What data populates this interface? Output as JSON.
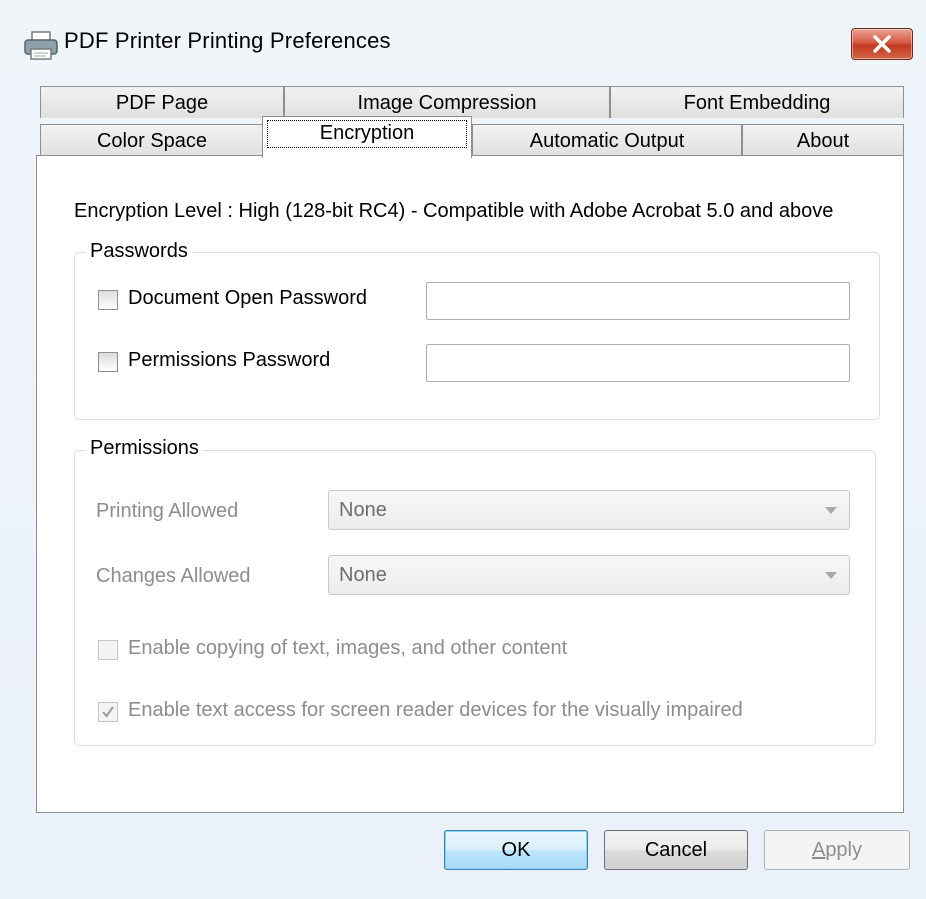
{
  "window": {
    "title": "PDF Printer Printing Preferences",
    "close_icon": "close-x-icon"
  },
  "tabs": {
    "row_back": [
      "PDF Page",
      "Image Compression",
      "Font Embedding"
    ],
    "row_front": [
      "Color Space",
      "Encryption",
      "Automatic Output",
      "About"
    ],
    "selected": "Encryption"
  },
  "encryption": {
    "level_text": "Encryption Level : High (128-bit RC4) - Compatible with Adobe Acrobat 5.0 and above"
  },
  "passwords": {
    "group_label": "Passwords",
    "doc_open_label": "Document Open Password",
    "doc_open_checked": false,
    "doc_open_value": "",
    "permissions_label": "Permissions Password",
    "permissions_checked": false,
    "permissions_value": ""
  },
  "permissions": {
    "group_label": "Permissions",
    "printing_label": "Printing Allowed",
    "printing_value": "None",
    "changes_label": "Changes Allowed",
    "changes_value": "None",
    "copy_label": "Enable copying of text, images, and other content",
    "copy_checked": false,
    "screenreader_label": "Enable text access for screen reader devices for the visually impaired",
    "screenreader_checked": true
  },
  "buttons": {
    "ok": "OK",
    "cancel": "Cancel",
    "apply_first": "A",
    "apply_rest": "pply"
  },
  "colors": {
    "accent": "#3c7fb1",
    "disabled_text": "#8d8d8d"
  }
}
